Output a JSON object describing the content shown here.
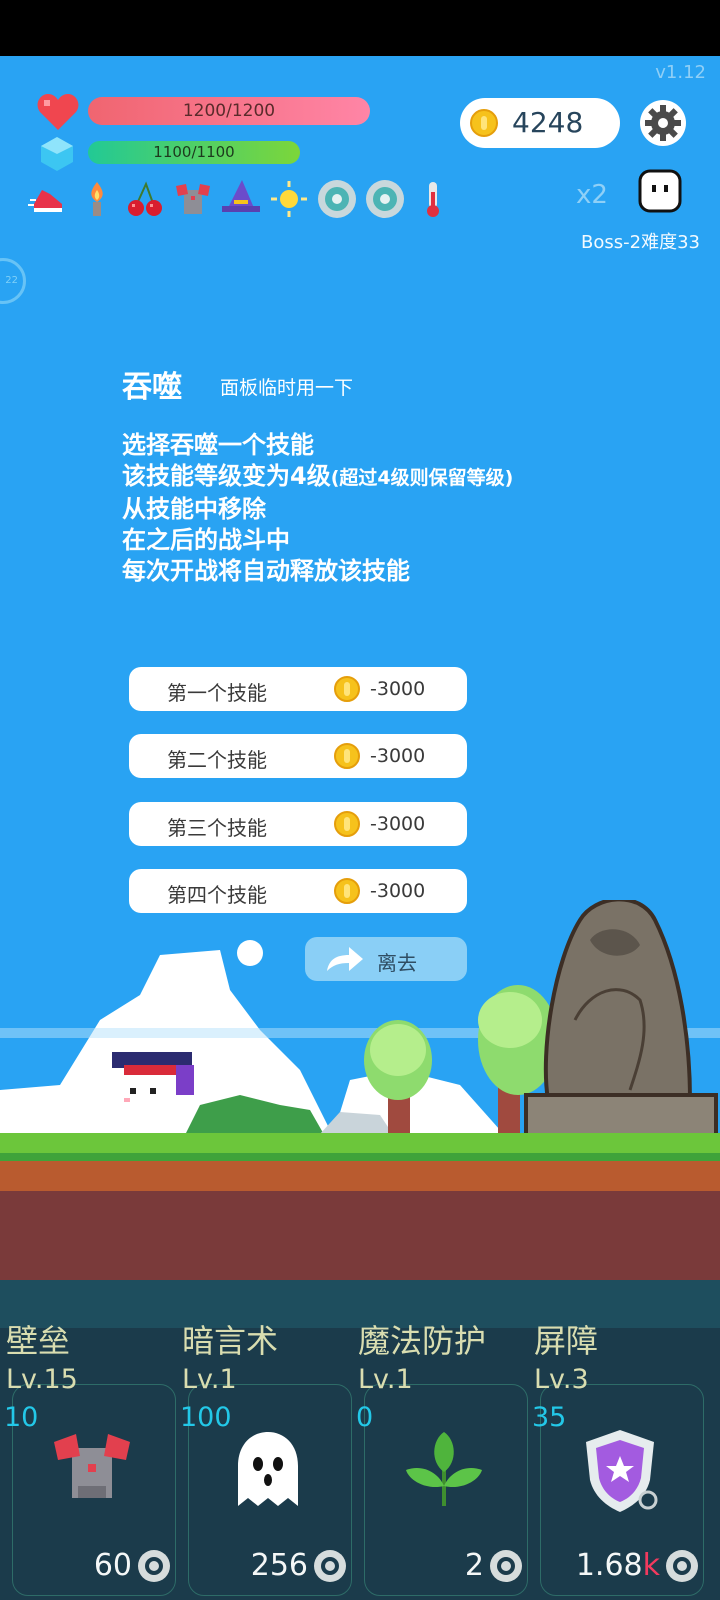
{
  "version": "v1.12",
  "player": {
    "hp": "1200/1200",
    "mp": "1100/1100"
  },
  "gold": "4248",
  "buff_icons": [
    "running-shoe-icon",
    "torch-icon",
    "cherry-icon",
    "armor-icon",
    "wizard-hat-icon",
    "sun-icon",
    "shield-ring-icon",
    "shield-ring-icon",
    "thermometer-icon"
  ],
  "speed": "x2",
  "boss": "Boss-2难度33",
  "panel": {
    "title": "吞噬",
    "subtitle": "面板临时用一下",
    "lines": [
      "选择吞噬一个技能",
      "该技能等级变为4级",
      "(超过4级则保留等级)",
      "从技能中移除",
      "在之后的战斗中",
      "每次开战将自动释放该技能"
    ],
    "options": [
      {
        "label": "第一个技能",
        "cost": "-3000"
      },
      {
        "label": "第二个技能",
        "cost": "-3000"
      },
      {
        "label": "第三个技能",
        "cost": "-3000"
      },
      {
        "label": "第四个技能",
        "cost": "-3000"
      }
    ],
    "leave": "离去"
  },
  "skills": [
    {
      "name": "壁垒",
      "level": "Lv.15",
      "value": "10",
      "count": "60",
      "icon": "armor-icon"
    },
    {
      "name": "暗言术",
      "level": "Lv.1",
      "value": "100",
      "count": "256",
      "icon": "ghost-icon"
    },
    {
      "name": "魔法防护",
      "level": "Lv.1",
      "value": "0",
      "count": "2",
      "icon": "leaf-icon"
    },
    {
      "name": "屏障",
      "level": "Lv.3",
      "value": "35",
      "count": "1.68",
      "count_suffix": "k",
      "icon": "shield-icon"
    }
  ],
  "colors": {
    "sky": "#29A3F3",
    "hp_bar": "#F06570",
    "mp_bar": "#22C995",
    "bottom_panel": "#1B3B4B",
    "skill_value": "#23C8E8",
    "skill_label": "#D9DDB0"
  }
}
